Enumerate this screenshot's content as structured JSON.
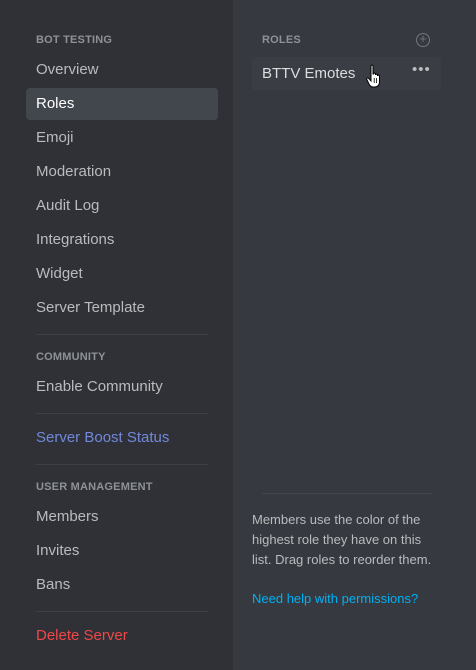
{
  "sidebar": {
    "server_header": "BOT TESTING",
    "items": [
      {
        "label": "Overview"
      },
      {
        "label": "Roles"
      },
      {
        "label": "Emoji"
      },
      {
        "label": "Moderation"
      },
      {
        "label": "Audit Log"
      },
      {
        "label": "Integrations"
      },
      {
        "label": "Widget"
      },
      {
        "label": "Server Template"
      }
    ],
    "community_header": "COMMUNITY",
    "community_items": [
      {
        "label": "Enable Community"
      }
    ],
    "boost_label": "Server Boost Status",
    "user_mgmt_header": "USER MANAGEMENT",
    "user_items": [
      {
        "label": "Members"
      },
      {
        "label": "Invites"
      },
      {
        "label": "Bans"
      }
    ],
    "delete_label": "Delete Server"
  },
  "main": {
    "roles_header": "ROLES",
    "add_icon": "plus-circle-icon",
    "roles": [
      {
        "name": "BTTV Emotes",
        "more_label": "•••"
      }
    ],
    "help_text": "Members use the color of the highest role they have on this list. Drag roles to reorder them.",
    "help_link": "Need help with permissions?"
  },
  "colors": {
    "sidebar_bg": "#2f3136",
    "main_bg": "#36393f",
    "boost": "#7289da",
    "danger": "#f04747",
    "link": "#00b0f4"
  }
}
